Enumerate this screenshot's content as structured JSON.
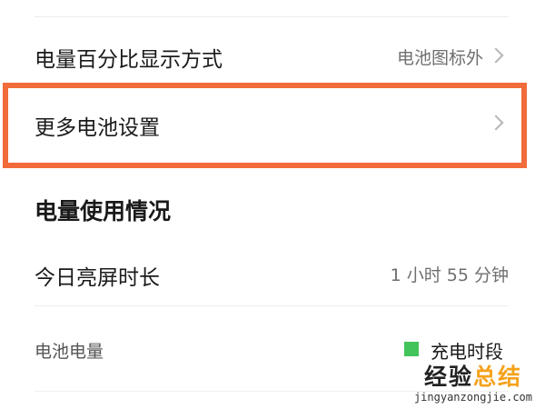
{
  "settings": {
    "percent_display": {
      "label": "电量百分比显示方式",
      "value": "电池图标外"
    },
    "more_battery": {
      "label": "更多电池设置"
    }
  },
  "usage": {
    "section_title": "电量使用情况",
    "screen_on": {
      "label": "今日亮屏时长",
      "value": "1 小时 55 分钟"
    },
    "battery_level_label": "电池电量",
    "legend_charging": "充电时段",
    "legend_color": "#43c45a"
  },
  "watermark": {
    "title_part1": "经验",
    "title_part2": "总结",
    "url": "jingyanzongjie.com"
  },
  "colors": {
    "highlight": "#f26b3a"
  }
}
